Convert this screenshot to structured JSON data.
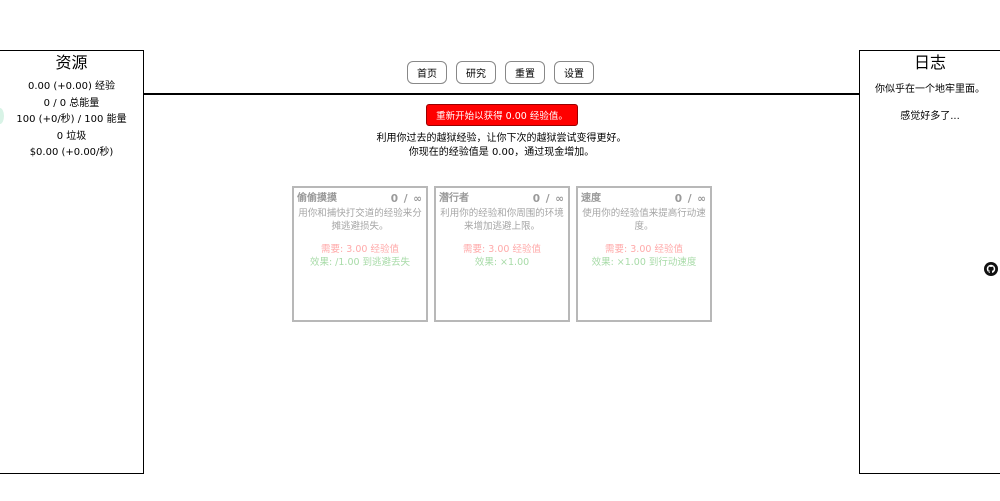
{
  "resources_panel": {
    "title": "资源",
    "lines": [
      "0.00 (+0.00) 经验",
      "0 / 0 总能量",
      "100 (+0/秒) / 100 能量",
      "0 垃圾",
      "$0.00 (+0.00/秒)"
    ]
  },
  "log_panel": {
    "title": "日志",
    "entries": [
      "你似乎在一个地牢里面。",
      "感觉好多了..."
    ]
  },
  "nav": {
    "home": "首页",
    "research": "研究",
    "reset": "重置",
    "settings": "设置"
  },
  "prestige": {
    "button_label": "重新开始以获得 0.00 经验值。",
    "info_line1": "利用你过去的越狱经验，让你下次的越狱尝试变得更好。",
    "info_line2": "你现在的经验值是 0.00，通过现金增加。"
  },
  "upgrades": [
    {
      "name": "偷偷摸摸",
      "level": "0 / ∞",
      "description": "用你和捕快打交道的经验来分摊逃避损失。",
      "cost": "需要: 3.00 经验值",
      "effect": "效果: /1.00 到逃避丢失"
    },
    {
      "name": "潜行者",
      "level": "0 / ∞",
      "description": "利用你的经验和你周围的环境来增加逃避上限。",
      "cost": "需要: 3.00 经验值",
      "effect": "效果: ×1.00"
    },
    {
      "name": "速度",
      "level": "0 / ∞",
      "description": "使用你的经验值来提高行动速度。",
      "cost": "需要: 3.00 经验值",
      "effect": "效果: ×1.00 到行动速度"
    }
  ],
  "icons": {
    "github": "github-icon"
  },
  "colors": {
    "prestige_bg": "#ff0000",
    "cost_text": "#ffaaaa",
    "effect_text": "#a8dba8",
    "card_border": "#b8b8b8"
  }
}
